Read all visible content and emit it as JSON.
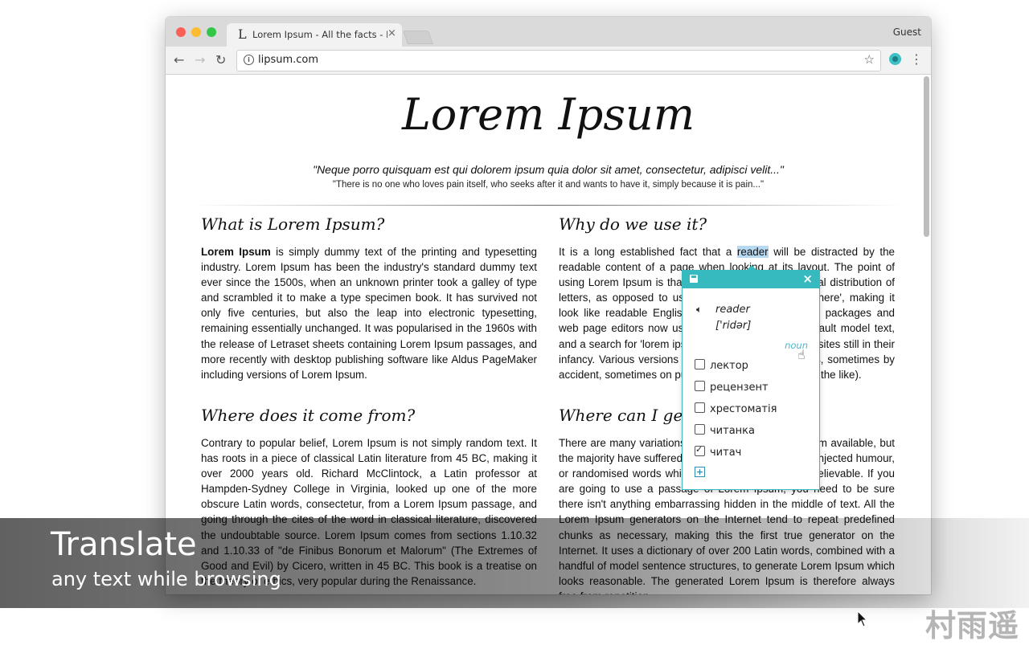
{
  "browser": {
    "tab_icon": "L",
    "tab_title": "Lorem Ipsum - All the facts - L",
    "tab_close": "×",
    "profile": "Guest",
    "url": "lipsum.com",
    "icons": [
      "back-icon",
      "forward-icon",
      "reload-icon",
      "info-icon",
      "star-icon",
      "extension-icon",
      "menu-icon"
    ]
  },
  "page": {
    "title": "Lorem Ipsum",
    "quote": "\"Neque porro quisquam est qui dolorem ipsum quia dolor sit amet, consectetur, adipisci velit...\"",
    "quote_sub": "\"There is no one who loves pain itself, who seeks after it and wants to have it, simply because it is pain...\"",
    "sections": {
      "what": {
        "heading": "What is Lorem Ipsum?",
        "lead": "Lorem Ipsum",
        "text": " is simply dummy text of the printing and typesetting industry. Lorem Ipsum has been the industry's standard dummy text ever since the 1500s, when an unknown printer took a galley of type and scrambled it to make a type specimen book. It has survived not only five centuries, but also the leap into electronic typesetting, remaining essentially unchanged. It was popularised in the 1960s with the release of Letraset sheets containing Lorem Ipsum passages, and more recently with desktop publishing software like Aldus PageMaker including versions of Lorem Ipsum."
      },
      "why": {
        "heading": "Why do we use it?",
        "before": "It is a long established fact that a ",
        "highlight": "reader",
        "after": " will be distracted by the readable content of a page when looking at its layout. The point of using Lorem Ipsum is that it has a more-or-less normal distribution of letters, as opposed to using 'Content here, content here', making it look like readable English. Many desktop publishing packages and web page editors now use Lorem Ipsum as their default model text, and a search for 'lorem ipsum' will uncover many web sites still in their infancy. Various versions have evolved over the years, sometimes by accident, sometimes on purpose (injected humour and the like)."
      },
      "where_from": {
        "heading": "Where does it come from?",
        "text": "Contrary to popular belief, Lorem Ipsum is not simply random text. It has roots in a piece of classical Latin literature from 45 BC, making it over 2000 years old. Richard McClintock, a Latin professor at Hampden-Sydney College in Virginia, looked up one of the more obscure Latin words, consectetur, from a Lorem Ipsum passage, and going through the cites of the word in classical literature, discovered the undoubtable source. Lorem Ipsum comes from sections 1.10.32 and 1.10.33 of \"de Finibus Bonorum et Malorum\" (The Extremes of Good and Evil) by Cicero, written in 45 BC. This book is a treatise on the theory of ethics, very popular during the Renaissance."
      },
      "where_get": {
        "heading": "Where can I get some?",
        "text": "There are many variations of passages of Lorem Ipsum available, but the majority have suffered alteration in some form, by injected humour, or randomised words which don't look even slightly believable. If you are going to use a passage of Lorem Ipsum, you need to be sure there isn't anything embarrassing hidden in the middle of text. All the Lorem Ipsum generators on the Internet tend to repeat predefined chunks as necessary, making this the first true generator on the Internet. It uses a dictionary of over 200 Latin words, combined with a handful of model sentence structures, to generate Lorem Ipsum which looks reasonable. The generated Lorem Ipsum is therefore always free from repetition."
      }
    }
  },
  "popup": {
    "close": "×",
    "word": "reader",
    "transcription": "['ridər]",
    "part_of_speech": "noun",
    "translations": [
      {
        "text": "лектор",
        "checked": false
      },
      {
        "text": "рецензент",
        "checked": false
      },
      {
        "text": "хрестоматія",
        "checked": false
      },
      {
        "text": "читанка",
        "checked": false
      },
      {
        "text": "читач",
        "checked": true
      }
    ],
    "accent_color": "#36b9bf"
  },
  "caption": {
    "title": "Translate",
    "subtitle": "any text while browsing"
  },
  "watermark": "村雨遥"
}
